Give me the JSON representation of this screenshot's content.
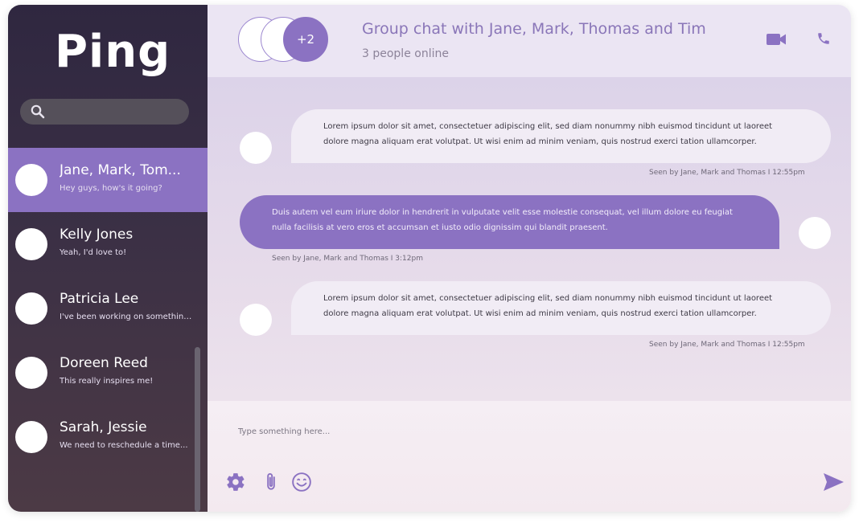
{
  "app": {
    "logo_text": "Ping"
  },
  "search": {
    "placeholder": "",
    "value": ""
  },
  "conversations": [
    {
      "name": "Jane, Mark, Tom...",
      "preview": "Hey guys, how's it going?",
      "active": true
    },
    {
      "name": "Kelly Jones",
      "preview": "Yeah, I'd love to!",
      "active": false
    },
    {
      "name": "Patricia Lee",
      "preview": "I've been working on something...",
      "active": false
    },
    {
      "name": "Doreen Reed",
      "preview": "This really inspires me!",
      "active": false
    },
    {
      "name": "Sarah, Jessie",
      "preview": "We need to reschedule a time...",
      "active": false
    }
  ],
  "header": {
    "extra_count": "+2",
    "title": "Group chat with Jane, Mark, Thomas and Tim",
    "subtitle": "3 people online"
  },
  "messages": [
    {
      "direction": "incoming",
      "text": "Lorem ipsum dolor sit amet, consectetuer adipiscing elit, sed diam nonummy nibh euismod tincidunt ut laoreet dolore magna aliquam erat volutpat. Ut wisi enim ad minim veniam, quis nostrud exerci tation ullamcorper.",
      "seen": "Seen by Jane, Mark and Thomas I 12:55pm"
    },
    {
      "direction": "outgoing",
      "text": "Duis autem vel eum iriure dolor in hendrerit in vulputate velit esse molestie consequat, vel illum dolore eu feugiat nulla facilisis at vero eros et accumsan et iusto odio dignissim qui blandit praesent.",
      "seen": "Seen by Jane, Mark and Thomas I 3:12pm"
    },
    {
      "direction": "incoming",
      "text": "Lorem ipsum dolor sit amet, consectetuer adipiscing elit, sed diam nonummy nibh euismod tincidunt ut laoreet dolore magna aliquam erat volutpat. Ut wisi enim ad minim veniam, quis nostrud exerci tation ullamcorper.",
      "seen": "Seen by Jane, Mark and Thomas I 12:55pm"
    }
  ],
  "composer": {
    "placeholder": "Type something here...",
    "value": ""
  },
  "icons": {
    "search": "search-icon",
    "video": "video-camera-icon",
    "phone": "phone-icon",
    "settings": "gear-icon",
    "attach": "paperclip-icon",
    "emoji": "smiley-icon",
    "send": "send-icon"
  },
  "colors": {
    "accent": "#8b72c2",
    "sidebar_top": "#2f2740",
    "sidebar_bottom": "#4c3a45",
    "header_bg": "#ebe5f3",
    "incoming_bubble": "#f1ecf5",
    "outgoing_bubble": "#8b72c2"
  }
}
